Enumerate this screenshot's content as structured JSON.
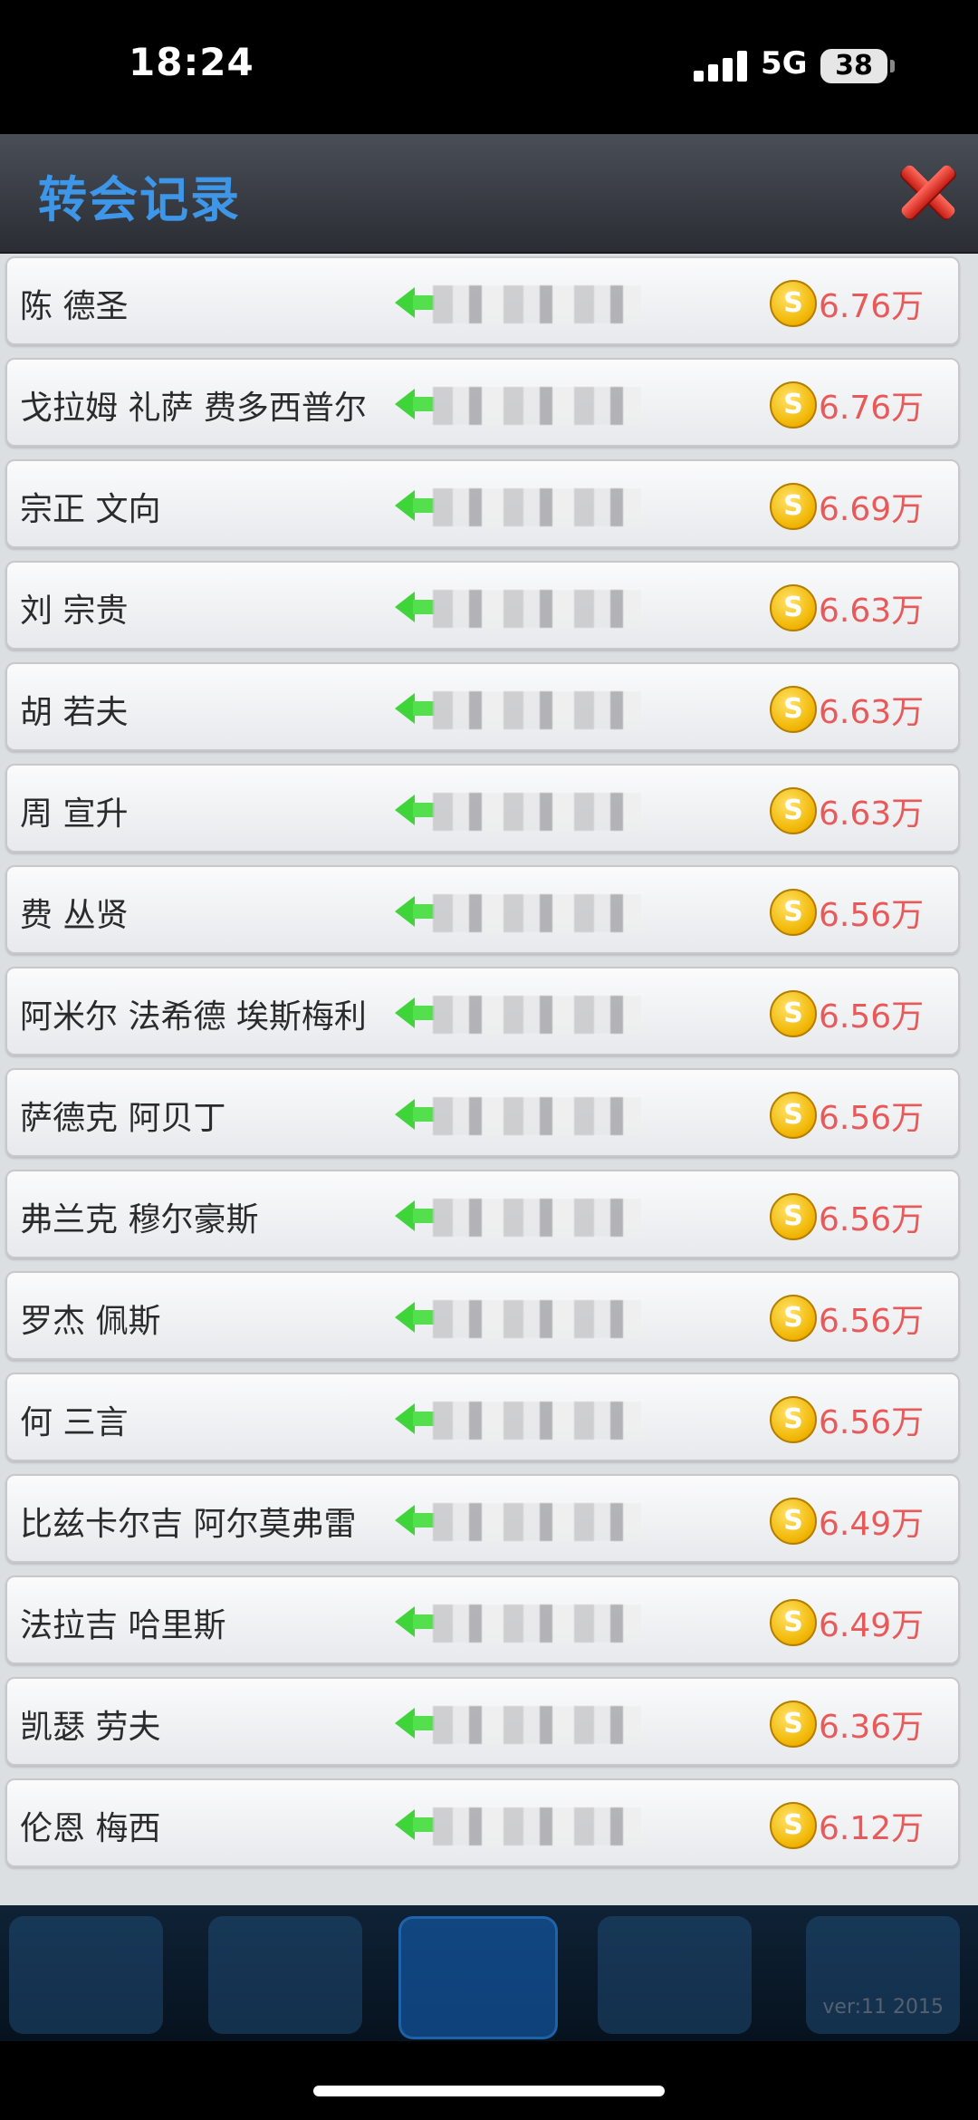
{
  "status_bar": {
    "time": "18:24",
    "network": "5G",
    "battery": "38"
  },
  "window": {
    "title": "转会记录"
  },
  "icons": {
    "close": "close-x-icon",
    "arrow": "green-arrow-left-icon",
    "coin": "gold-coin-icon"
  },
  "coin_symbol": "S",
  "transfers": [
    {
      "name": "陈 德圣",
      "price": "6.76万"
    },
    {
      "name": "戈拉姆 礼萨 费多西普尔",
      "price": "6.76万"
    },
    {
      "name": "宗正 文向",
      "price": "6.69万"
    },
    {
      "name": "刘 宗贵",
      "price": "6.63万"
    },
    {
      "name": "胡 若夫",
      "price": "6.63万"
    },
    {
      "name": "周 宣升",
      "price": "6.63万"
    },
    {
      "name": "费 丛贤",
      "price": "6.56万"
    },
    {
      "name": "阿米尔 法希德 埃斯梅利",
      "price": "6.56万"
    },
    {
      "name": "萨德克 阿贝丁",
      "price": "6.56万"
    },
    {
      "name": "弗兰克 穆尔豪斯",
      "price": "6.56万"
    },
    {
      "name": "罗杰 佩斯",
      "price": "6.56万"
    },
    {
      "name": "何 三言",
      "price": "6.56万"
    },
    {
      "name": "比兹卡尔吉 阿尔莫弗雷",
      "price": "6.49万"
    },
    {
      "name": "法拉吉 哈里斯",
      "price": "6.49万"
    },
    {
      "name": "凯瑟 劳夫",
      "price": "6.36万"
    },
    {
      "name": "伦恩 梅西",
      "price": "6.12万"
    }
  ],
  "footer": {
    "version": "ver:11  2015"
  }
}
